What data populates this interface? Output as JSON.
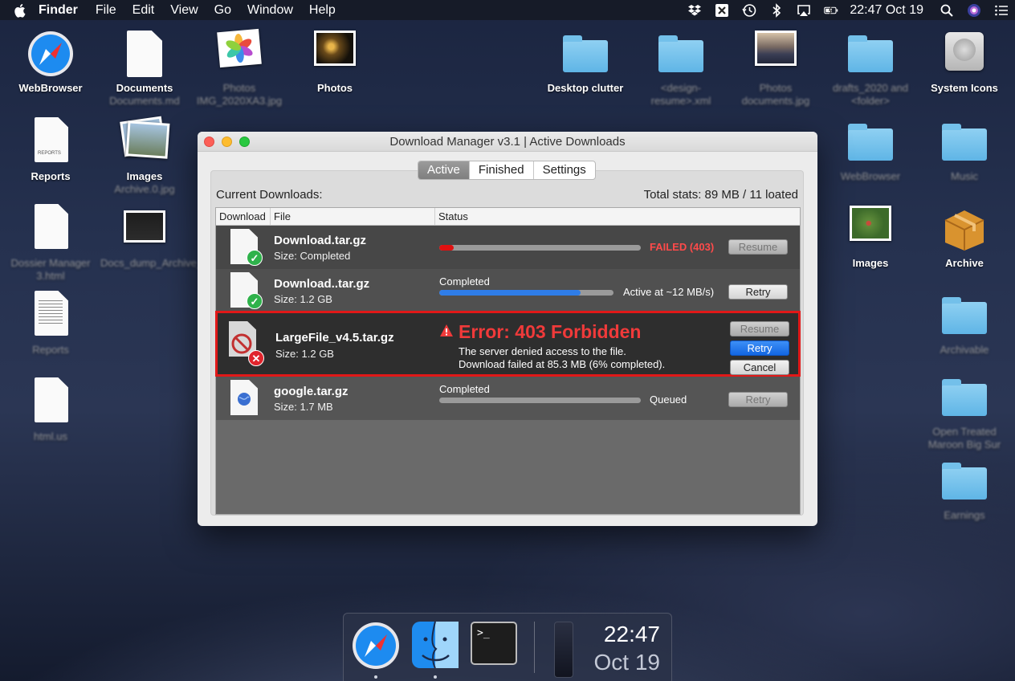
{
  "menubar": {
    "app_name": "Finder",
    "items": [
      "File",
      "Edit",
      "View",
      "Go",
      "Window",
      "Help"
    ],
    "clock": "22:47  Oct 19",
    "status_icons": [
      "dropbox-icon",
      "x-box-icon",
      "time-machine-icon",
      "bluetooth-icon",
      "airplay-icon",
      "battery-icon",
      "search-icon",
      "siri-icon",
      "control-list-icon"
    ]
  },
  "desktop": {
    "icons": [
      {
        "label": "WebBrowser",
        "kind": "compass"
      },
      {
        "label": "Documents",
        "sublabel": "Documents.md",
        "kind": "doc"
      },
      {
        "label": "Photos",
        "sublabel": "IMG_2020XA3.jpg",
        "kind": "photos-app"
      },
      {
        "label": "Photos",
        "kind": "photo"
      },
      {
        "label": "Desktop clutter",
        "kind": "folder"
      },
      {
        "label": "<design-resume>.xml",
        "kind": "folder"
      },
      {
        "label": "Photos documents.jpg",
        "kind": "photo"
      },
      {
        "label": "drafts_2020 and <folder>",
        "kind": "folder"
      },
      {
        "label": "System Icons",
        "kind": "drive"
      },
      {
        "label": "Reports",
        "kind": "doc"
      },
      {
        "label": "Images",
        "sublabel": "Archive.0.jpg",
        "kind": "images"
      },
      {
        "label": "WebBrowser",
        "kind": "folder"
      },
      {
        "label": "Music",
        "kind": "folder"
      },
      {
        "label": "Dossier Manager 3.html",
        "kind": "doc"
      },
      {
        "label": "Docs_dump_Archive_f.jpg",
        "kind": "screen"
      },
      {
        "label": "Images",
        "kind": "photo"
      },
      {
        "label": "Archive",
        "kind": "box"
      },
      {
        "label": "Reports",
        "kind": "doc"
      },
      {
        "label": "Archivable",
        "kind": "folder"
      },
      {
        "label": "html.us",
        "kind": "doc"
      },
      {
        "label": "Open Treated Maroon Big Sur",
        "kind": "folder"
      },
      {
        "label": "Earnings",
        "kind": "folder"
      }
    ],
    "reports_doc_text": "REPORTS"
  },
  "window": {
    "title": "Download Manager v3.1 | Active Downloads",
    "tabs": [
      "Active",
      "Finished",
      "Settings"
    ],
    "active_tab": "Active",
    "current_label": "Current Downloads:",
    "totals": "Total stats: 89 MB / 11 loated",
    "columns": [
      "Download",
      "File",
      "Status"
    ],
    "rows": [
      {
        "name": "Download.tar.gz",
        "size": "Size: Completed",
        "status": "FAILED (403)",
        "progress": 0.07,
        "button": "Resume",
        "badge": "✓"
      },
      {
        "name": "Download..tar.gz",
        "size": "Size: 1.2 GB",
        "status_top": "Completed",
        "status": "Active at ~12 MB/s)",
        "progress": 0.81,
        "button": "Retry",
        "badge": "✓"
      },
      {
        "name": "LargeFile_v4.5.tar.gz",
        "size": "Size: 1.2 GB",
        "error_title": "Error: 403 Forbidden",
        "error_line1": "The server denied access to the file.",
        "error_line2": "Download failed at 85.3 MB (6% completed).",
        "buttons": [
          "Resume",
          "Retry",
          "Cancel"
        ],
        "badge": "✕"
      },
      {
        "name": "google.tar.gz",
        "size": "Size: 1.7 MB",
        "status_top": "Completed",
        "status": "Queued",
        "progress": 0.0,
        "button": "Retry"
      }
    ],
    "colors": {
      "error": "#f03a3a",
      "progress_blue": "#2f7de8",
      "progress_red": "#e01010",
      "primary": "#1266e2"
    }
  },
  "dock": {
    "apps": [
      "safari-icon",
      "finder-icon",
      "terminal-icon",
      "phone-icon"
    ],
    "terminal_prompt": ">_",
    "time": "22:47",
    "date": "Oct 19"
  }
}
